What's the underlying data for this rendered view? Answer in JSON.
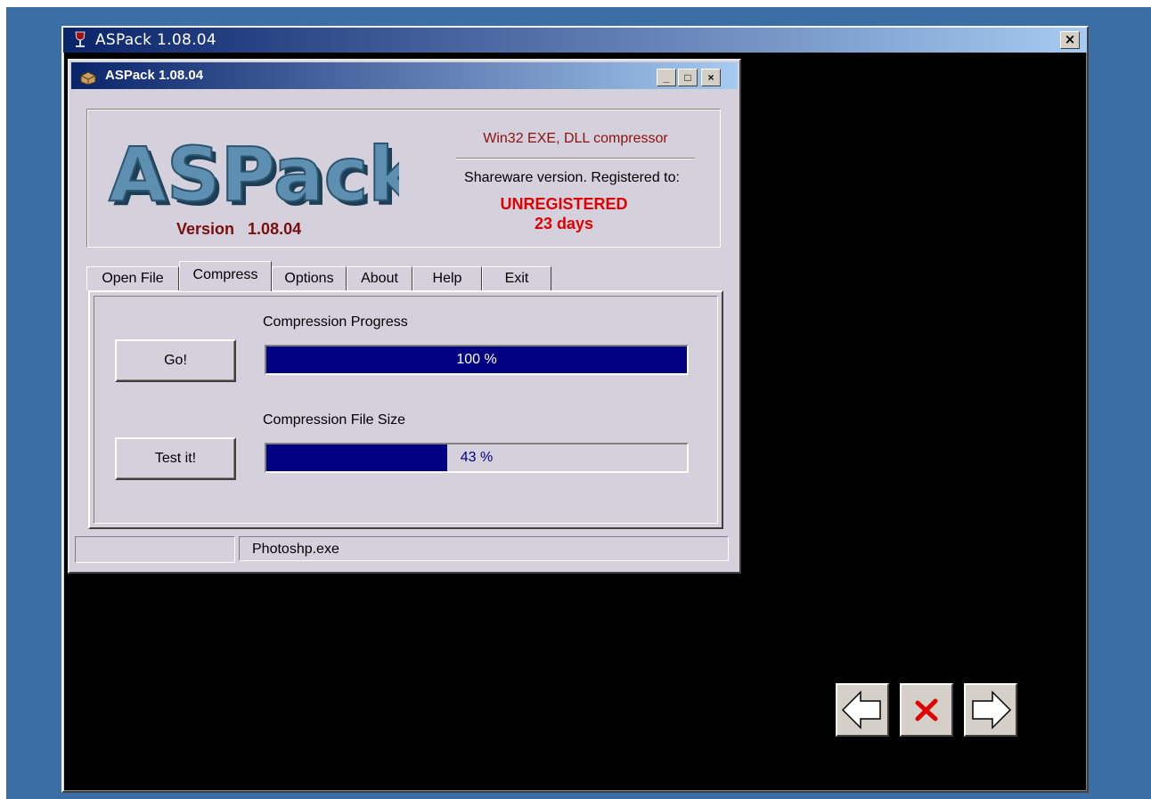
{
  "outer_window": {
    "title": "ASPack 1.08.04",
    "close_label": "×"
  },
  "dialog": {
    "title": "ASPack 1.08.04",
    "minimize_label": "_",
    "maximize_label": "□",
    "close_label": "×"
  },
  "header": {
    "logo_text": "ASPack",
    "version_label": "Version",
    "version_value": "1.08.04",
    "tagline": "Win32 EXE, DLL compressor",
    "registration_text": "Shareware version. Registered to:",
    "registration_status": "UNREGISTERED",
    "days_left": "23 days"
  },
  "tabs": [
    {
      "label": "Open File",
      "active": false
    },
    {
      "label": "Compress",
      "active": true
    },
    {
      "label": "Options",
      "active": false
    },
    {
      "label": "About",
      "active": false
    },
    {
      "label": "Help",
      "active": false
    },
    {
      "label": "Exit",
      "active": false
    }
  ],
  "compress": {
    "progress_label": "Compression Progress",
    "progress_percent": 100,
    "progress_text": "100 %",
    "go_button": "Go!",
    "size_label": "Compression File Size",
    "size_percent": 43,
    "size_text": "43 %",
    "test_button": "Test it!"
  },
  "statusbar": {
    "left": "",
    "file": "Photoshp.exe"
  },
  "nav": {
    "back_icon": "left-arrow-icon",
    "cancel_icon": "red-x-icon",
    "forward_icon": "right-arrow-icon"
  },
  "colors": {
    "desktop": "#3a6ea5",
    "title_gradient_start": "#0a246a",
    "progress_fill": "#000080",
    "unregistered": "#e00000",
    "version": "#7a0d0d"
  }
}
